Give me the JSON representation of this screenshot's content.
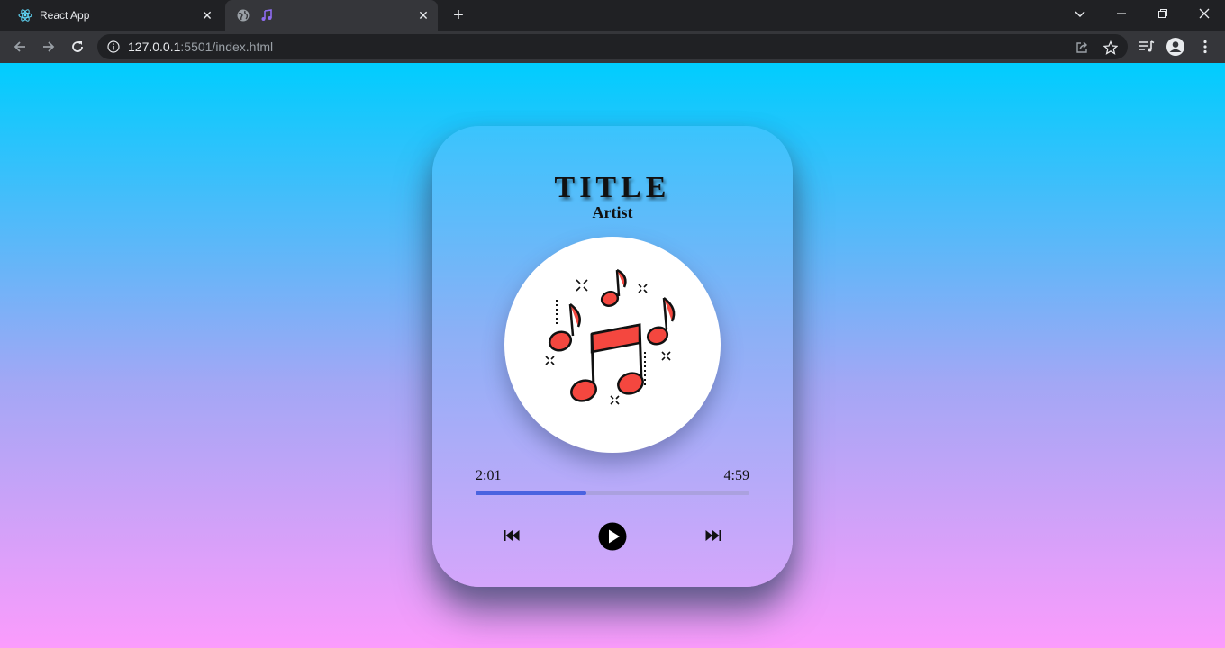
{
  "browser": {
    "tabs": [
      {
        "title": "React App",
        "favicon": "react-icon"
      },
      {
        "title": "",
        "favicon": "globe-icon",
        "extra_icon": "music-note-icon"
      }
    ],
    "address": {
      "host": "127.0.0.1",
      "rest": ":5501/index.html"
    },
    "icons": [
      "back-icon",
      "forward-icon",
      "reload-icon",
      "info-icon",
      "share-icon",
      "star-icon",
      "media-icon",
      "profile-icon",
      "menu-icon"
    ]
  },
  "player": {
    "title": "TITLE",
    "artist": "Artist",
    "current_time": "2:01",
    "total_time": "4:59",
    "progress": 0.405,
    "colors": {
      "accent": "#4a63e0",
      "note": "#f4473f"
    }
  }
}
